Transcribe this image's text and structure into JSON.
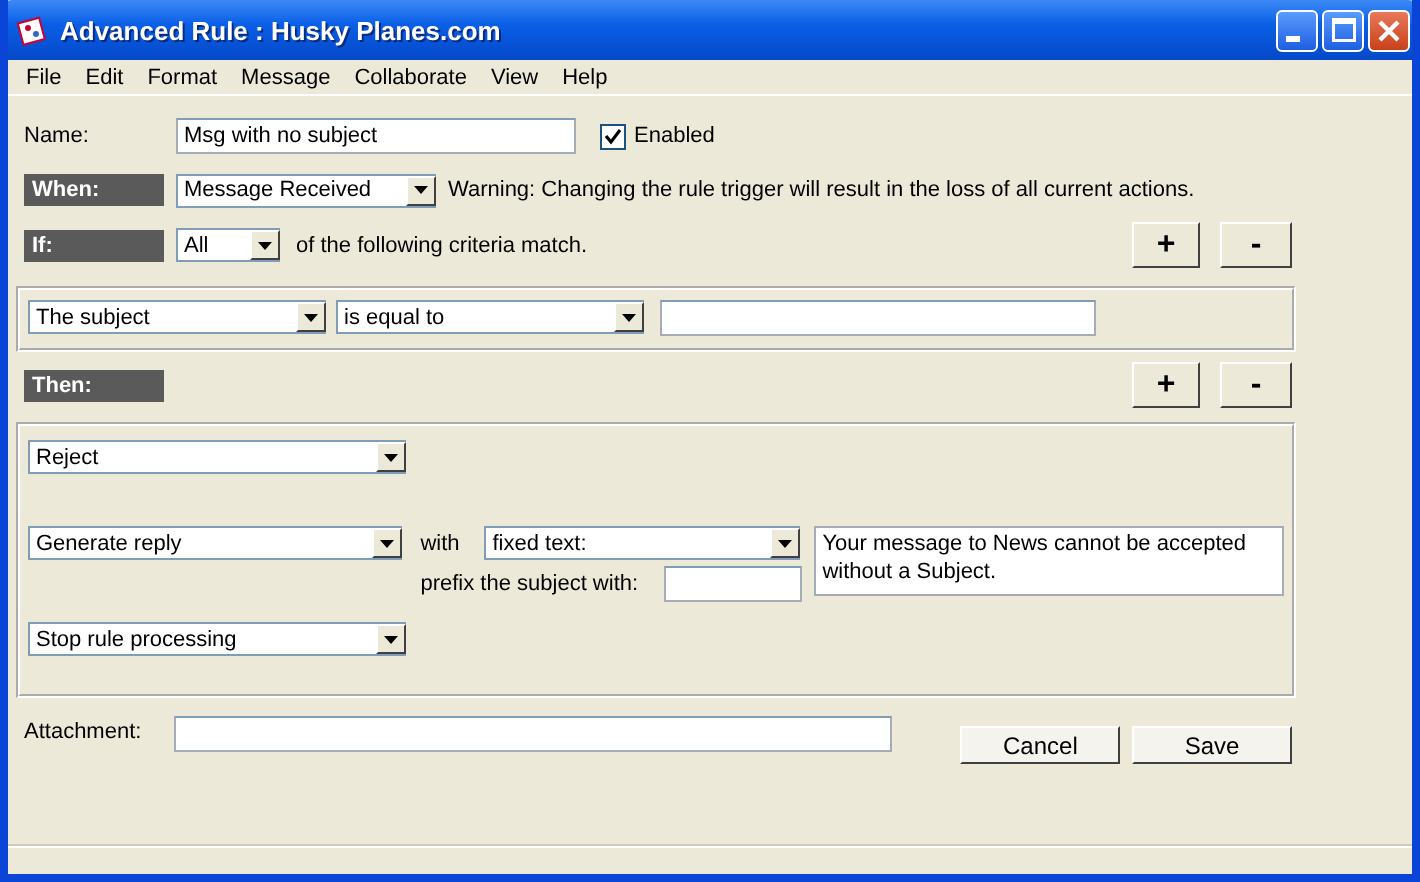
{
  "window": {
    "title": "Advanced Rule : Husky Planes.com"
  },
  "menu": [
    "File",
    "Edit",
    "Format",
    "Message",
    "Collaborate",
    "View",
    "Help"
  ],
  "name": {
    "label": "Name:",
    "value": "Msg with no subject"
  },
  "enabled": {
    "label": "Enabled",
    "checked": true
  },
  "when": {
    "label": "When:",
    "trigger": "Message Received",
    "warning": "Warning:  Changing the rule trigger will result in the loss of all current actions."
  },
  "if": {
    "label": "If:",
    "match": "All",
    "text": "of the following criteria match.",
    "add": "+",
    "remove": "-"
  },
  "criteria": [
    {
      "field": "The subject",
      "operator": "is equal to"
    }
  ],
  "then": {
    "label": "Then:",
    "add": "+",
    "remove": "-"
  },
  "actions": [
    {
      "kind": "simple",
      "action": "Reject"
    },
    {
      "kind": "reply",
      "action": "Generate reply",
      "with": "with",
      "source": "fixed text:",
      "prefix_label": "prefix the subject with:",
      "message": "Your message to News cannot be accepted without a Subject."
    },
    {
      "kind": "simple",
      "action": "Stop rule processing"
    }
  ],
  "attachment": {
    "label": "Attachment:"
  },
  "buttons": [
    "Cancel",
    "Save"
  ]
}
